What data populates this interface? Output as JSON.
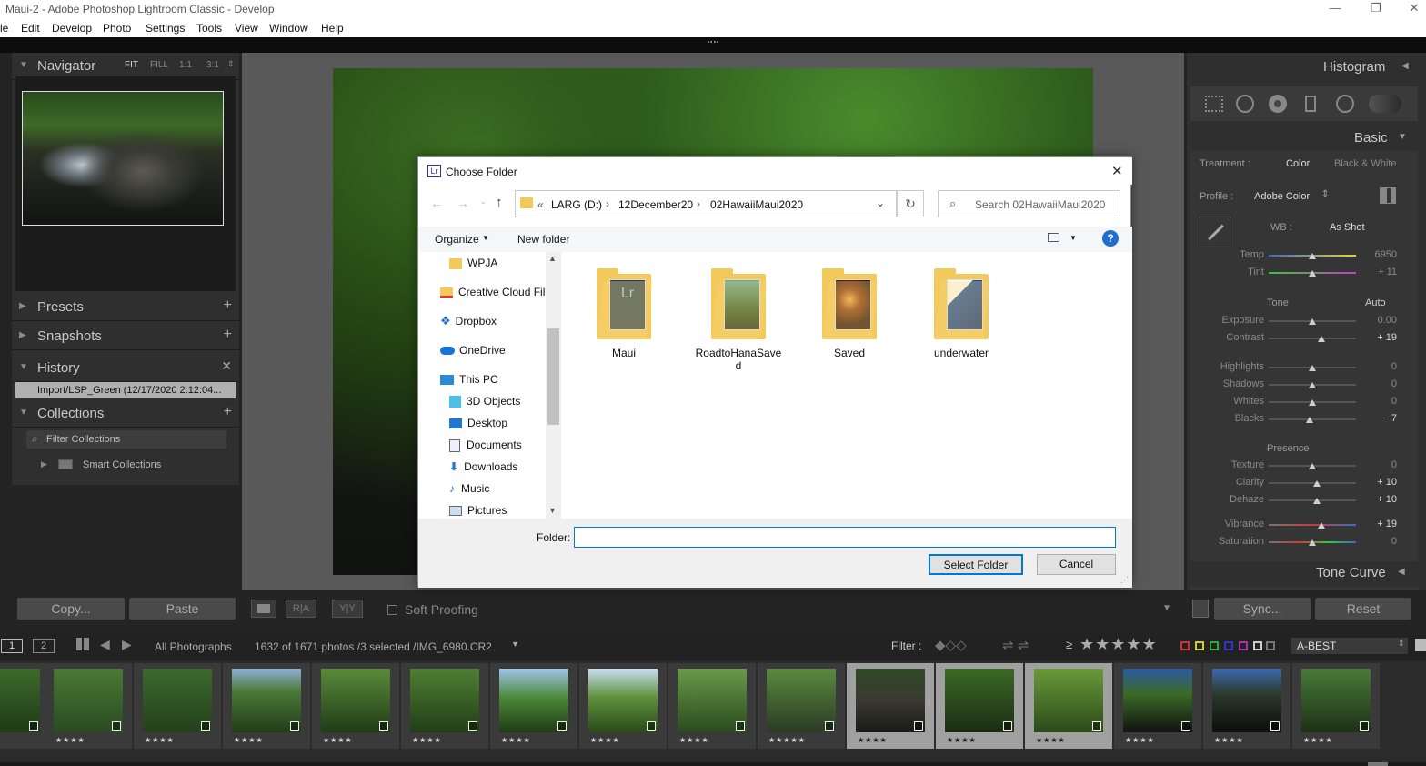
{
  "window": {
    "title": "Maui-2 - Adobe Photoshop Lightroom Classic - Develop",
    "minimize": "—",
    "maximize": "❐",
    "close": "✕"
  },
  "menu": [
    "le",
    "Edit",
    "Develop",
    "Photo",
    "Settings",
    "Tools",
    "View",
    "Window",
    "Help"
  ],
  "left_panel": {
    "navigator": {
      "label": "Navigator",
      "zoom": [
        "FIT",
        "FILL",
        "1:1",
        "3:1"
      ]
    },
    "presets": "Presets",
    "snapshots": "Snapshots",
    "history": {
      "label": "History",
      "item": "Import/LSP_Green (12/17/2020 2:12:04..."
    },
    "collections": {
      "label": "Collections",
      "filter": "Filter Collections",
      "item": "Smart Collections"
    },
    "copy": "Copy...",
    "paste": "Paste"
  },
  "toolbar": {
    "soft_proofing": "Soft Proofing"
  },
  "right_panel": {
    "histogram": "Histogram",
    "basic": "Basic",
    "treatment_label": "Treatment :",
    "treatment_color": "Color",
    "treatment_bw": "Black & White",
    "profile_label": "Profile :",
    "profile_value": "Adobe Color",
    "wb_label": "WB :",
    "wb_value": "As Shot",
    "tone_label": "Tone",
    "auto": "Auto",
    "presence_label": "Presence",
    "sliders": [
      {
        "label": "Temp",
        "value": "6950",
        "hi": false
      },
      {
        "label": "Tint",
        "value": "+ 11",
        "hi": false
      },
      {
        "label": "Exposure",
        "value": "0.00",
        "hi": false
      },
      {
        "label": "Contrast",
        "value": "+ 19",
        "hi": true
      },
      {
        "label": "Highlights",
        "value": "0",
        "hi": false
      },
      {
        "label": "Shadows",
        "value": "0",
        "hi": false
      },
      {
        "label": "Whites",
        "value": "0",
        "hi": false
      },
      {
        "label": "Blacks",
        "value": "− 7",
        "hi": true
      },
      {
        "label": "Texture",
        "value": "0",
        "hi": false
      },
      {
        "label": "Clarity",
        "value": "+ 10",
        "hi": true
      },
      {
        "label": "Dehaze",
        "value": "+ 10",
        "hi": true
      },
      {
        "label": "Vibrance",
        "value": "+ 19",
        "hi": true
      },
      {
        "label": "Saturation",
        "value": "0",
        "hi": false
      }
    ],
    "tone_curve": "Tone Curve",
    "sync": "Sync...",
    "reset": "Reset"
  },
  "filmstrip_bar": {
    "page1": "1",
    "page2": "2",
    "source": "All Photographs",
    "count": "1632 of 1671 photos /3 selected /IMG_6980.CR2",
    "filter_label": "Filter :",
    "rating_op": "≥",
    "stars": "★★★★★",
    "preset": "A-BEST"
  },
  "filmstrip": [
    {
      "stars": "",
      "sel": false
    },
    {
      "stars": "★★★★",
      "sel": false
    },
    {
      "stars": "★★★★",
      "sel": false
    },
    {
      "stars": "★★★★",
      "sel": false
    },
    {
      "stars": "★★★★",
      "sel": false
    },
    {
      "stars": "★★★★",
      "sel": false
    },
    {
      "stars": "★★★★",
      "sel": false
    },
    {
      "stars": "★★★★",
      "sel": false
    },
    {
      "stars": "★★★★",
      "sel": false
    },
    {
      "stars": "★★★★★",
      "sel": false
    },
    {
      "stars": "★★★★",
      "sel": true
    },
    {
      "stars": "★★★★",
      "sel": true
    },
    {
      "stars": "★★★★",
      "sel": true
    },
    {
      "stars": "★★★★",
      "sel": false
    },
    {
      "stars": "★★★★",
      "sel": false
    },
    {
      "stars": "★★★★",
      "sel": false
    }
  ],
  "dialog": {
    "title": "Choose Folder",
    "app_badge": "Lr",
    "breadcrumb": [
      "«",
      "LARG (D:)",
      "12December20",
      "02HawaiiMaui2020"
    ],
    "search_placeholder": "Search 02HawaiiMaui2020",
    "organize": "Organize",
    "new_folder": "New folder",
    "tree": [
      "WPJA",
      "Creative Cloud Fil",
      "Dropbox",
      "OneDrive",
      "This PC",
      "3D Objects",
      "Desktop",
      "Documents",
      "Downloads",
      "Music",
      "Pictures"
    ],
    "folders": [
      {
        "name": "Maui",
        "name2": ""
      },
      {
        "name": "RoadtoHanaSave",
        "name2": "d"
      },
      {
        "name": "Saved",
        "name2": ""
      },
      {
        "name": "underwater",
        "name2": ""
      }
    ],
    "folder_label": "Folder:",
    "folder_value": "",
    "select_button": "Select Folder",
    "cancel_button": "Cancel"
  }
}
